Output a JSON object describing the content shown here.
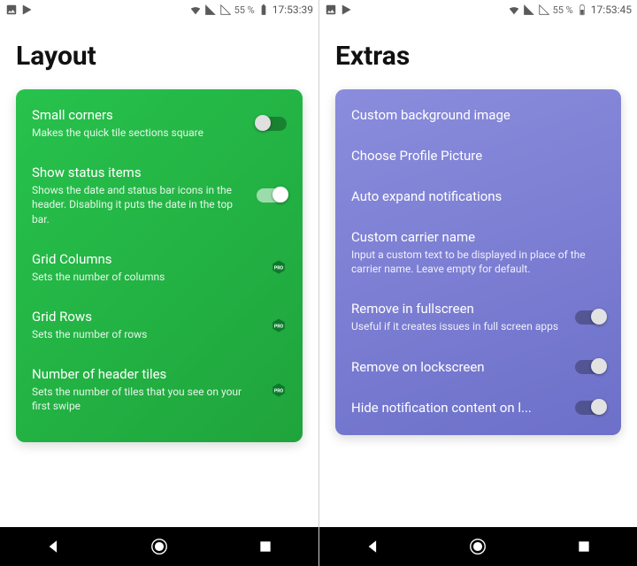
{
  "left": {
    "statusbar": {
      "battery_pct": "55 %",
      "time": "17:53:39"
    },
    "heading": "Layout",
    "card": {
      "items": [
        {
          "title": "Small corners",
          "subtitle": "Makes the quick tile sections square",
          "control": "toggle",
          "state": "off"
        },
        {
          "title": "Show status items",
          "subtitle": "Shows the date and status bar icons in the header. Disabling it puts the date in the top bar.",
          "control": "toggle",
          "state": "on"
        },
        {
          "title": "Grid Columns",
          "subtitle": "Sets the number of columns",
          "control": "pro"
        },
        {
          "title": "Grid Rows",
          "subtitle": "Sets the number of rows",
          "control": "pro"
        },
        {
          "title": "Number of header tiles",
          "subtitle": "Sets the number of tiles that you see on your first swipe",
          "control": "pro"
        }
      ]
    }
  },
  "right": {
    "statusbar": {
      "battery_pct": "55 %",
      "time": "17:53:45"
    },
    "heading": "Extras",
    "card": {
      "items": [
        {
          "title": "Custom background image",
          "subtitle": "",
          "control": "none"
        },
        {
          "title": "Choose Profile Picture",
          "subtitle": "",
          "control": "none"
        },
        {
          "title": "Auto expand notifications",
          "subtitle": "",
          "control": "none"
        },
        {
          "title": "Custom carrier name",
          "subtitle": "Input a custom text to be displayed in place of the carrier name. Leave empty for default.",
          "control": "none"
        },
        {
          "title": "Remove in fullscreen",
          "subtitle": "Useful if it creates issues in full screen apps",
          "control": "toggle",
          "state": "off"
        },
        {
          "title": "Remove on lockscreen",
          "subtitle": "",
          "control": "toggle",
          "state": "off"
        },
        {
          "title": "Hide notification content on l...",
          "subtitle": "",
          "control": "toggle",
          "state": "off"
        }
      ]
    }
  }
}
